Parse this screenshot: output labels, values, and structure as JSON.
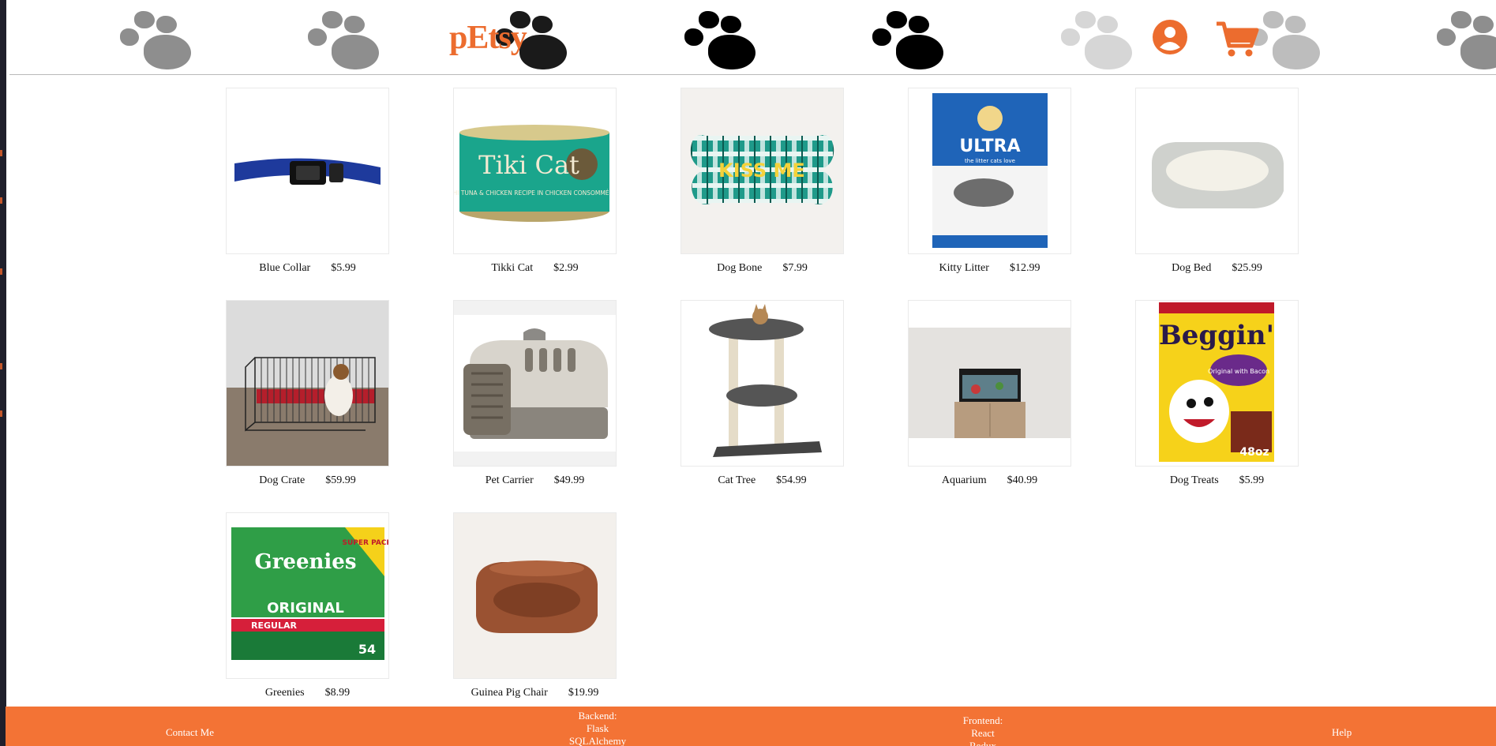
{
  "brand": {
    "logo": "pEtsy",
    "accent": "#ec6c2e",
    "footer_color": "#f37335"
  },
  "header": {
    "user_icon": "user-circle-icon",
    "cart_icon": "cart-icon",
    "background_pattern_icon": "paw-print-icon"
  },
  "products": [
    {
      "name": "Blue Collar",
      "price": "$5.99"
    },
    {
      "name": "Tikki Cat",
      "price": "$2.99"
    },
    {
      "name": "Dog Bone",
      "price": "$7.99"
    },
    {
      "name": "Kitty Litter",
      "price": "$12.99"
    },
    {
      "name": "Dog Bed",
      "price": "$25.99"
    },
    {
      "name": "Dog Crate",
      "price": "$59.99"
    },
    {
      "name": "Pet Carrier",
      "price": "$49.99"
    },
    {
      "name": "Cat Tree",
      "price": "$54.99"
    },
    {
      "name": "Aquarium",
      "price": "$40.99"
    },
    {
      "name": "Dog Treats",
      "price": "$5.99"
    },
    {
      "name": "Greenies",
      "price": "$8.99"
    },
    {
      "name": "Guinea Pig Chair",
      "price": "$19.99"
    }
  ],
  "product_image_text": {
    "tiki": "Tiki Cat",
    "tiki_sub": "AHI TUNA & CHICKEN RECIPE IN CHICKEN CONSOMMÉ",
    "bone": "KISS ME",
    "litter": "ULTRA",
    "litter_sub": "the litter cats love",
    "beggin": "Beggin'",
    "beggin_sub": "Original with Bacon",
    "beggin_size": "48oz",
    "greenies": "Greenies",
    "greenies_orig": "ORIGINAL",
    "greenies_reg": "REGULAR",
    "greenies_super": "SUPER PACK!",
    "greenies_count": "54"
  },
  "footer": {
    "contact": "Contact Me",
    "backend": [
      "Backend:",
      "Flask",
      "SQLAlchemy"
    ],
    "frontend": [
      "Frontend:",
      "React",
      "Redux"
    ],
    "help": "Help"
  }
}
